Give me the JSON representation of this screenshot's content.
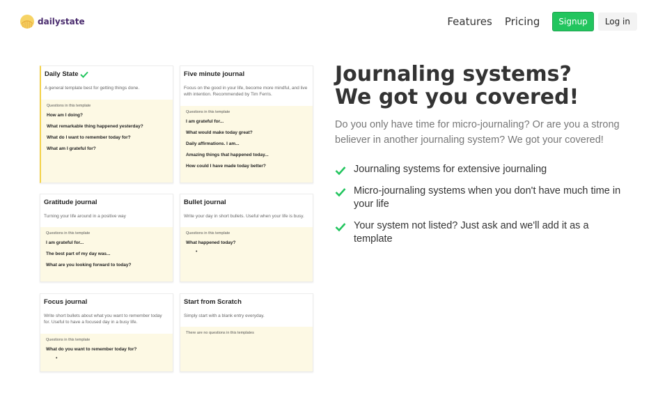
{
  "header": {
    "logo_text": "dailystate",
    "nav": {
      "features": "Features",
      "pricing": "Pricing"
    },
    "signup": "Signup",
    "login": "Log in"
  },
  "colors": {
    "accent_green": "#22c55e",
    "logo_purple": "#4a2c6e",
    "card_question_bg": "#fdf9e4",
    "selected_border": "#f3d24a"
  },
  "cards": [
    {
      "title": "Daily State",
      "desc": "A general template best for getting things done.",
      "q_head": "Questions in this template",
      "questions": [
        "How am I doing?",
        "What remarkable thing happened yesterday?",
        "What do I want to remember today for?",
        "What am I grateful for?"
      ]
    },
    {
      "title": "Five minute journal",
      "desc": "Focus on the good in your life, become more mindful, and live with intention. Recommended by Tim Ferris.",
      "q_head": "Questions in this template",
      "questions": [
        "I am grateful for...",
        "What would make today great?",
        "Daily affirmations. I am...",
        "Amazing things that happened today...",
        "How could I have made today better?"
      ]
    },
    {
      "title": "Gratitude journal",
      "desc": "Turning your life around in a positive way",
      "q_head": "Questions in this template",
      "questions": [
        "I am grateful for...",
        "The best part of my day was...",
        "What are you looking forward to today?"
      ]
    },
    {
      "title": "Bullet journal",
      "desc": "Write your day in short bullets. Useful when your life is busy.",
      "q_head": "Questions in this template",
      "questions": [
        "What happened today?"
      ],
      "bullet": "•"
    },
    {
      "title": "Focus journal",
      "desc": "Write short bullets about what you want to remember today for. Useful to have a focused day in a busy life.",
      "q_head": "Questions in this template",
      "questions": [
        "What do you want to remember today for?"
      ],
      "bullet": "•"
    },
    {
      "title": "Start from Scratch",
      "desc": "Simply start with a blank entry everyday.",
      "q_empty": "There are no questions in this templates"
    }
  ],
  "hero": {
    "headline_1": "Journaling systems?",
    "headline_2": "We got you covered!",
    "subtitle": "Do you only have time for micro-journaling? Or are you a strong believer in another journaling system? We got your covered!",
    "features": [
      "Journaling systems for extensive journaling",
      "Micro-journaling systems when you don't have much time in your life",
      "Your system not listed? Just ask and we'll add it as a template"
    ]
  }
}
